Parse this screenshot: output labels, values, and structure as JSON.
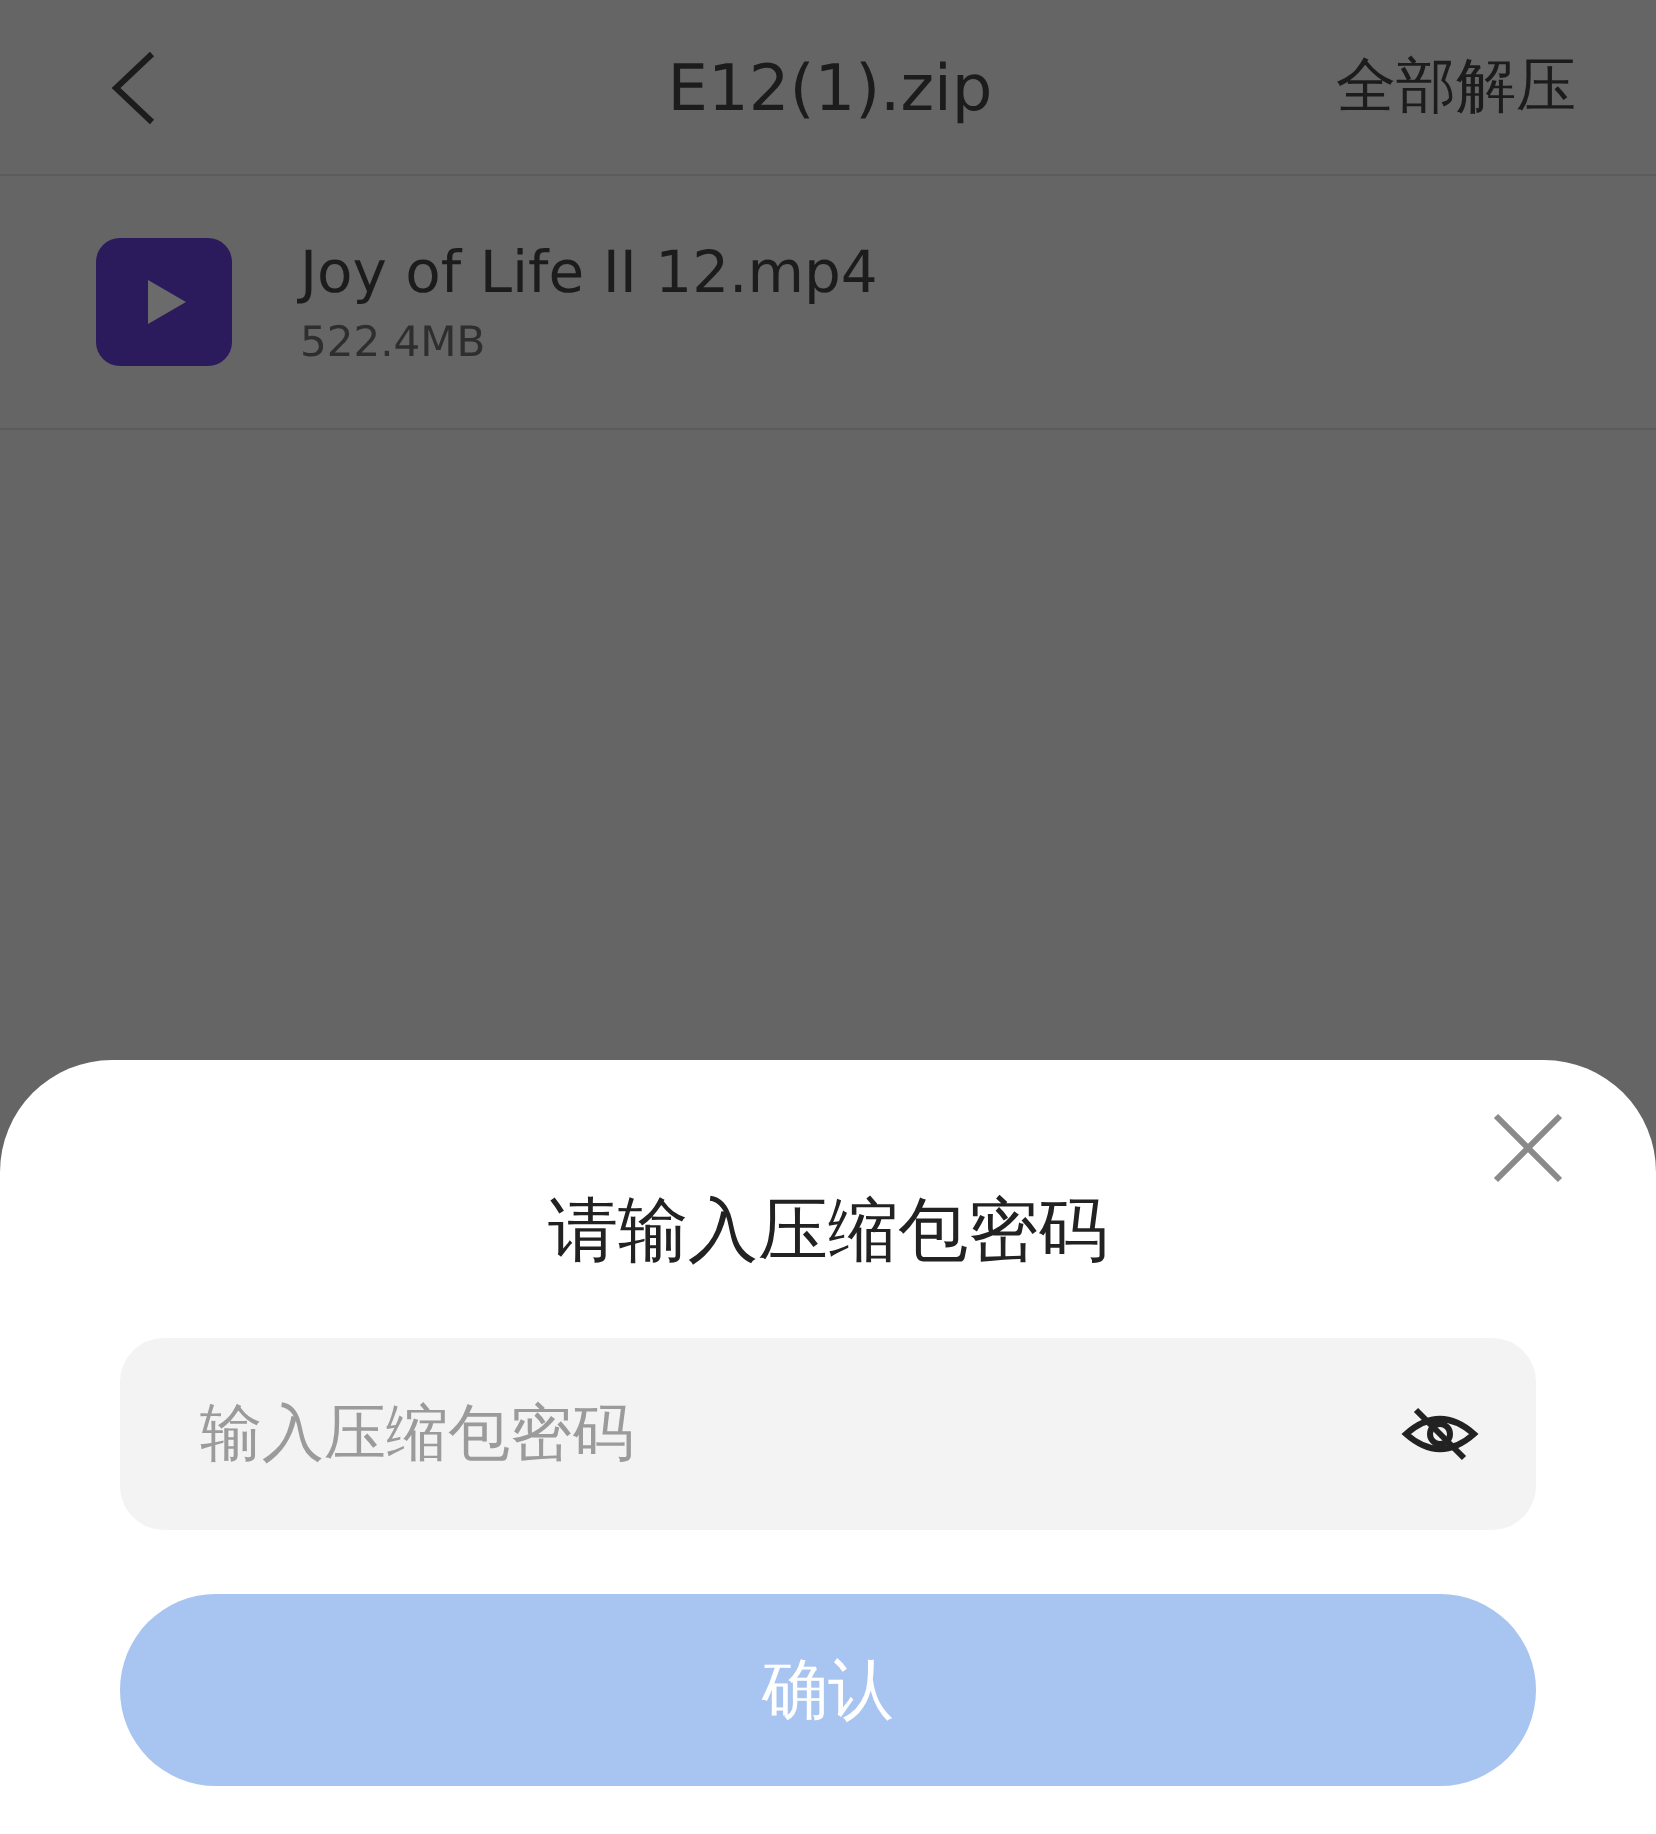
{
  "header": {
    "title": "E12(1).zip",
    "action": "全部解压"
  },
  "files": [
    {
      "name": "Joy of Life II 12.mp4",
      "size": "522.4MB"
    }
  ],
  "dialog": {
    "title": "请输入压缩包密码",
    "password_field": {
      "placeholder": "输入压缩包密码"
    },
    "confirm_button": {
      "label": "确认",
      "disabled": true
    }
  }
}
